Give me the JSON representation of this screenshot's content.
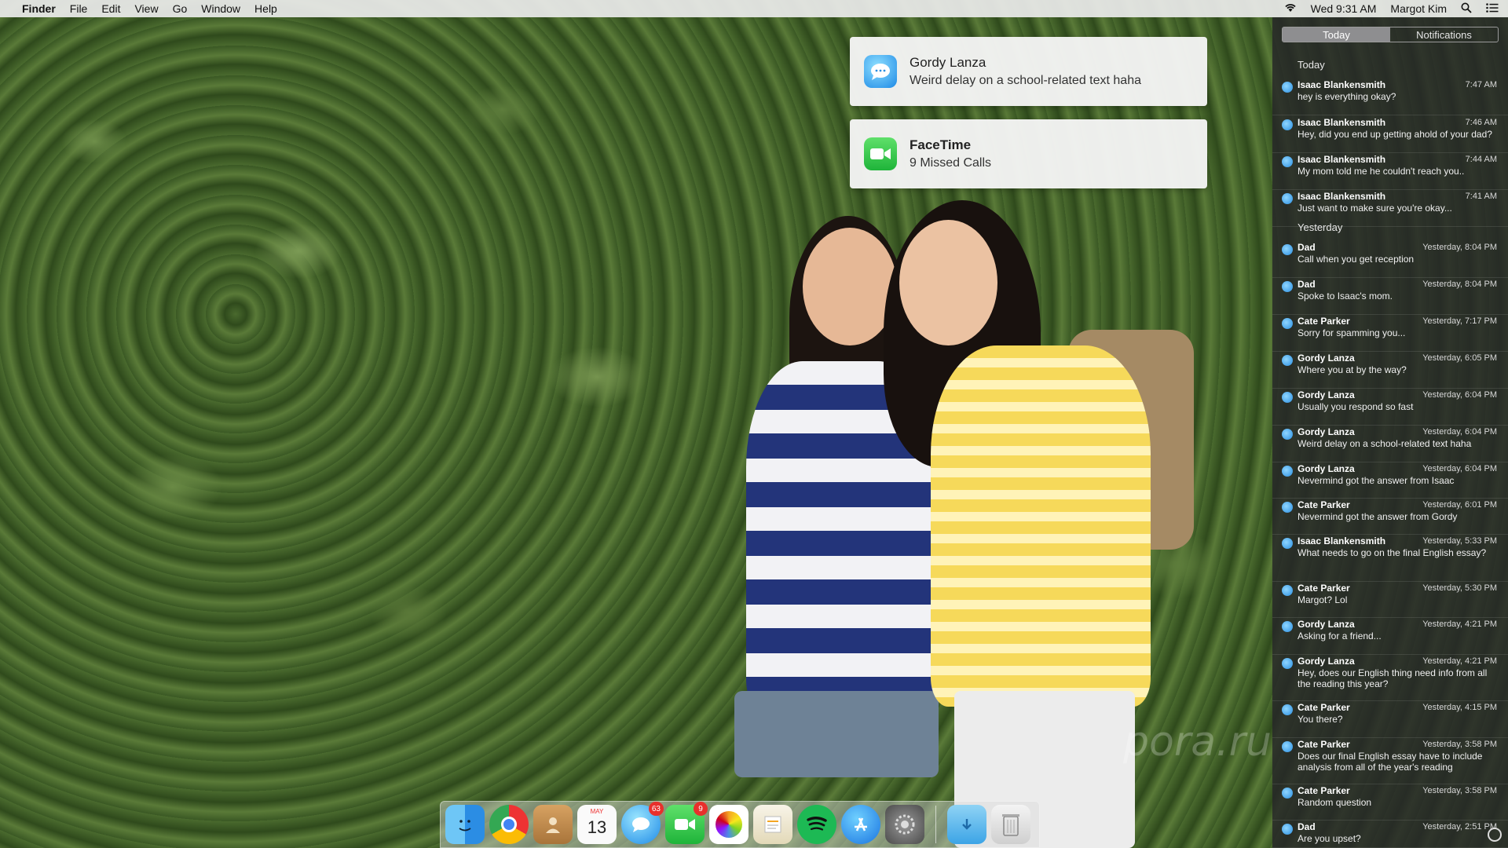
{
  "menubar": {
    "app": "Finder",
    "menus": [
      "File",
      "Edit",
      "View",
      "Go",
      "Window",
      "Help"
    ],
    "clock": "Wed 9:31 AM",
    "user": "Margot Kim"
  },
  "banners": [
    {
      "title": "Gordy Lanza",
      "body": "Weird delay on a school-related text haha"
    },
    {
      "title": "FaceTime",
      "body": "9 Missed Calls"
    }
  ],
  "notification_center": {
    "tabs": [
      "Today",
      "Notifications"
    ],
    "active_tab": "Today",
    "sections": {
      "today": "Today",
      "yesterday": "Yesterday"
    },
    "today_items": [
      {
        "sender": "Isaac Blankensmith",
        "time": "7:47 AM",
        "msg": "hey is everything okay?"
      },
      {
        "sender": "Isaac Blankensmith",
        "time": "7:46 AM",
        "msg": "Hey, did you end up getting ahold of your dad?"
      },
      {
        "sender": "Isaac Blankensmith",
        "time": "7:44 AM",
        "msg": "My mom told me he couldn't reach you.."
      },
      {
        "sender": "Isaac Blankensmith",
        "time": "7:41 AM",
        "msg": "Just want to make sure you're okay..."
      }
    ],
    "yesterday_items": [
      {
        "sender": "Dad",
        "time": "Yesterday, 8:04 PM",
        "msg": "Call when you get reception"
      },
      {
        "sender": "Dad",
        "time": "Yesterday, 8:04 PM",
        "msg": "Spoke to Isaac's mom."
      },
      {
        "sender": "Cate Parker",
        "time": "Yesterday, 7:17 PM",
        "msg": "Sorry for spamming you..."
      },
      {
        "sender": "Gordy Lanza",
        "time": "Yesterday, 6:05 PM",
        "msg": "Where you at by the way?"
      },
      {
        "sender": "Gordy Lanza",
        "time": "Yesterday, 6:04 PM",
        "msg": "Usually you respond so fast"
      },
      {
        "sender": "Gordy Lanza",
        "time": "Yesterday, 6:04 PM",
        "msg": "Weird delay on a school-related text haha"
      },
      {
        "sender": "Gordy Lanza",
        "time": "Yesterday, 6:04 PM",
        "msg": "Nevermind got the answer from Isaac"
      },
      {
        "sender": "Cate Parker",
        "time": "Yesterday, 6:01 PM",
        "msg": "Nevermind got the answer from Gordy"
      },
      {
        "sender": "Isaac Blankensmith",
        "time": "Yesterday, 5:33 PM",
        "msg": "What needs to go on the final English essay?"
      },
      {
        "sender": "Cate Parker",
        "time": "Yesterday, 5:30 PM",
        "msg": "Margot? Lol"
      },
      {
        "sender": "Gordy Lanza",
        "time": "Yesterday, 4:21 PM",
        "msg": "Asking for a friend..."
      },
      {
        "sender": "Gordy Lanza",
        "time": "Yesterday, 4:21 PM",
        "msg": "Hey, does our English thing need info from all the reading this year?"
      },
      {
        "sender": "Cate Parker",
        "time": "Yesterday, 4:15 PM",
        "msg": "You there?"
      },
      {
        "sender": "Cate Parker",
        "time": "Yesterday, 3:58 PM",
        "msg": "Does our final English essay have to include analysis from all of the year's reading"
      },
      {
        "sender": "Cate Parker",
        "time": "Yesterday, 3:58 PM",
        "msg": "Random question"
      },
      {
        "sender": "Dad",
        "time": "Yesterday, 2:51 PM",
        "msg": "Are you upset?"
      }
    ]
  },
  "dock": {
    "calendar_month": "MAY",
    "calendar_day": "13",
    "messages_badge": "63",
    "facetime_badge": "9"
  },
  "watermark": "pora.ru"
}
